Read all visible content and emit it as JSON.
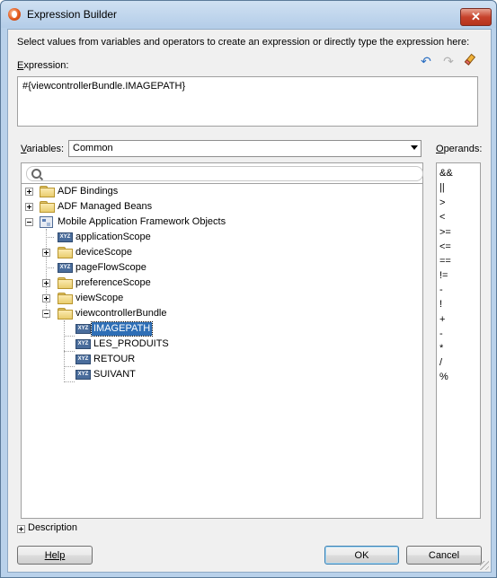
{
  "window": {
    "title": "Expression Builder",
    "close_glyph": "✕"
  },
  "instructions": "Select values from variables and operators to create an expression or directly type the expression here:",
  "expression": {
    "label_mnemonic": "E",
    "label_rest": "xpression:",
    "value": "#{viewcontrollerBundle.IMAGEPATH}",
    "tools": [
      "undo-icon",
      "redo-icon",
      "clear-icon"
    ]
  },
  "variables": {
    "label_mnemonic": "V",
    "label_rest": "ariables:",
    "selected_scope": "Common",
    "tree": [
      {
        "label": "ADF Bindings",
        "icon": "folder-icon",
        "expander": "plus"
      },
      {
        "label": "ADF Managed Beans",
        "icon": "folder-icon",
        "expander": "plus"
      },
      {
        "label": "Mobile Application Framework Objects",
        "icon": "maf-objects-icon",
        "expander": "minus"
      },
      {
        "label": "applicationScope",
        "icon": "variable-icon",
        "expander": "none"
      },
      {
        "label": "deviceScope",
        "icon": "folder-icon",
        "expander": "plus"
      },
      {
        "label": "pageFlowScope",
        "icon": "variable-icon",
        "expander": "none"
      },
      {
        "label": "preferenceScope",
        "icon": "folder-icon",
        "expander": "plus"
      },
      {
        "label": "viewScope",
        "icon": "folder-icon",
        "expander": "plus"
      },
      {
        "label": "viewcontrollerBundle",
        "icon": "folder-icon",
        "expander": "minus"
      },
      {
        "label": "IMAGEPATH",
        "icon": "variable-icon",
        "expander": "none",
        "selected": true
      },
      {
        "label": "LES_PRODUITS",
        "icon": "variable-icon",
        "expander": "none"
      },
      {
        "label": "RETOUR",
        "icon": "variable-icon",
        "expander": "none"
      },
      {
        "label": "SUIVANT",
        "icon": "variable-icon",
        "expander": "none"
      }
    ]
  },
  "operands": {
    "label_mnemonic": "O",
    "label_rest": "perands:",
    "items": [
      "&&",
      "||",
      ">",
      "<",
      ">=",
      "<=",
      "==",
      "!=",
      "-",
      "!",
      "+",
      "-",
      "*",
      "/",
      "%"
    ]
  },
  "description": {
    "label": "Description"
  },
  "buttons": {
    "help": "Help",
    "ok": "OK",
    "cancel": "Cancel"
  },
  "colors": {
    "selection": "#2f6fb6",
    "title_bar": "#b9d1ea",
    "close": "#c7432c"
  }
}
